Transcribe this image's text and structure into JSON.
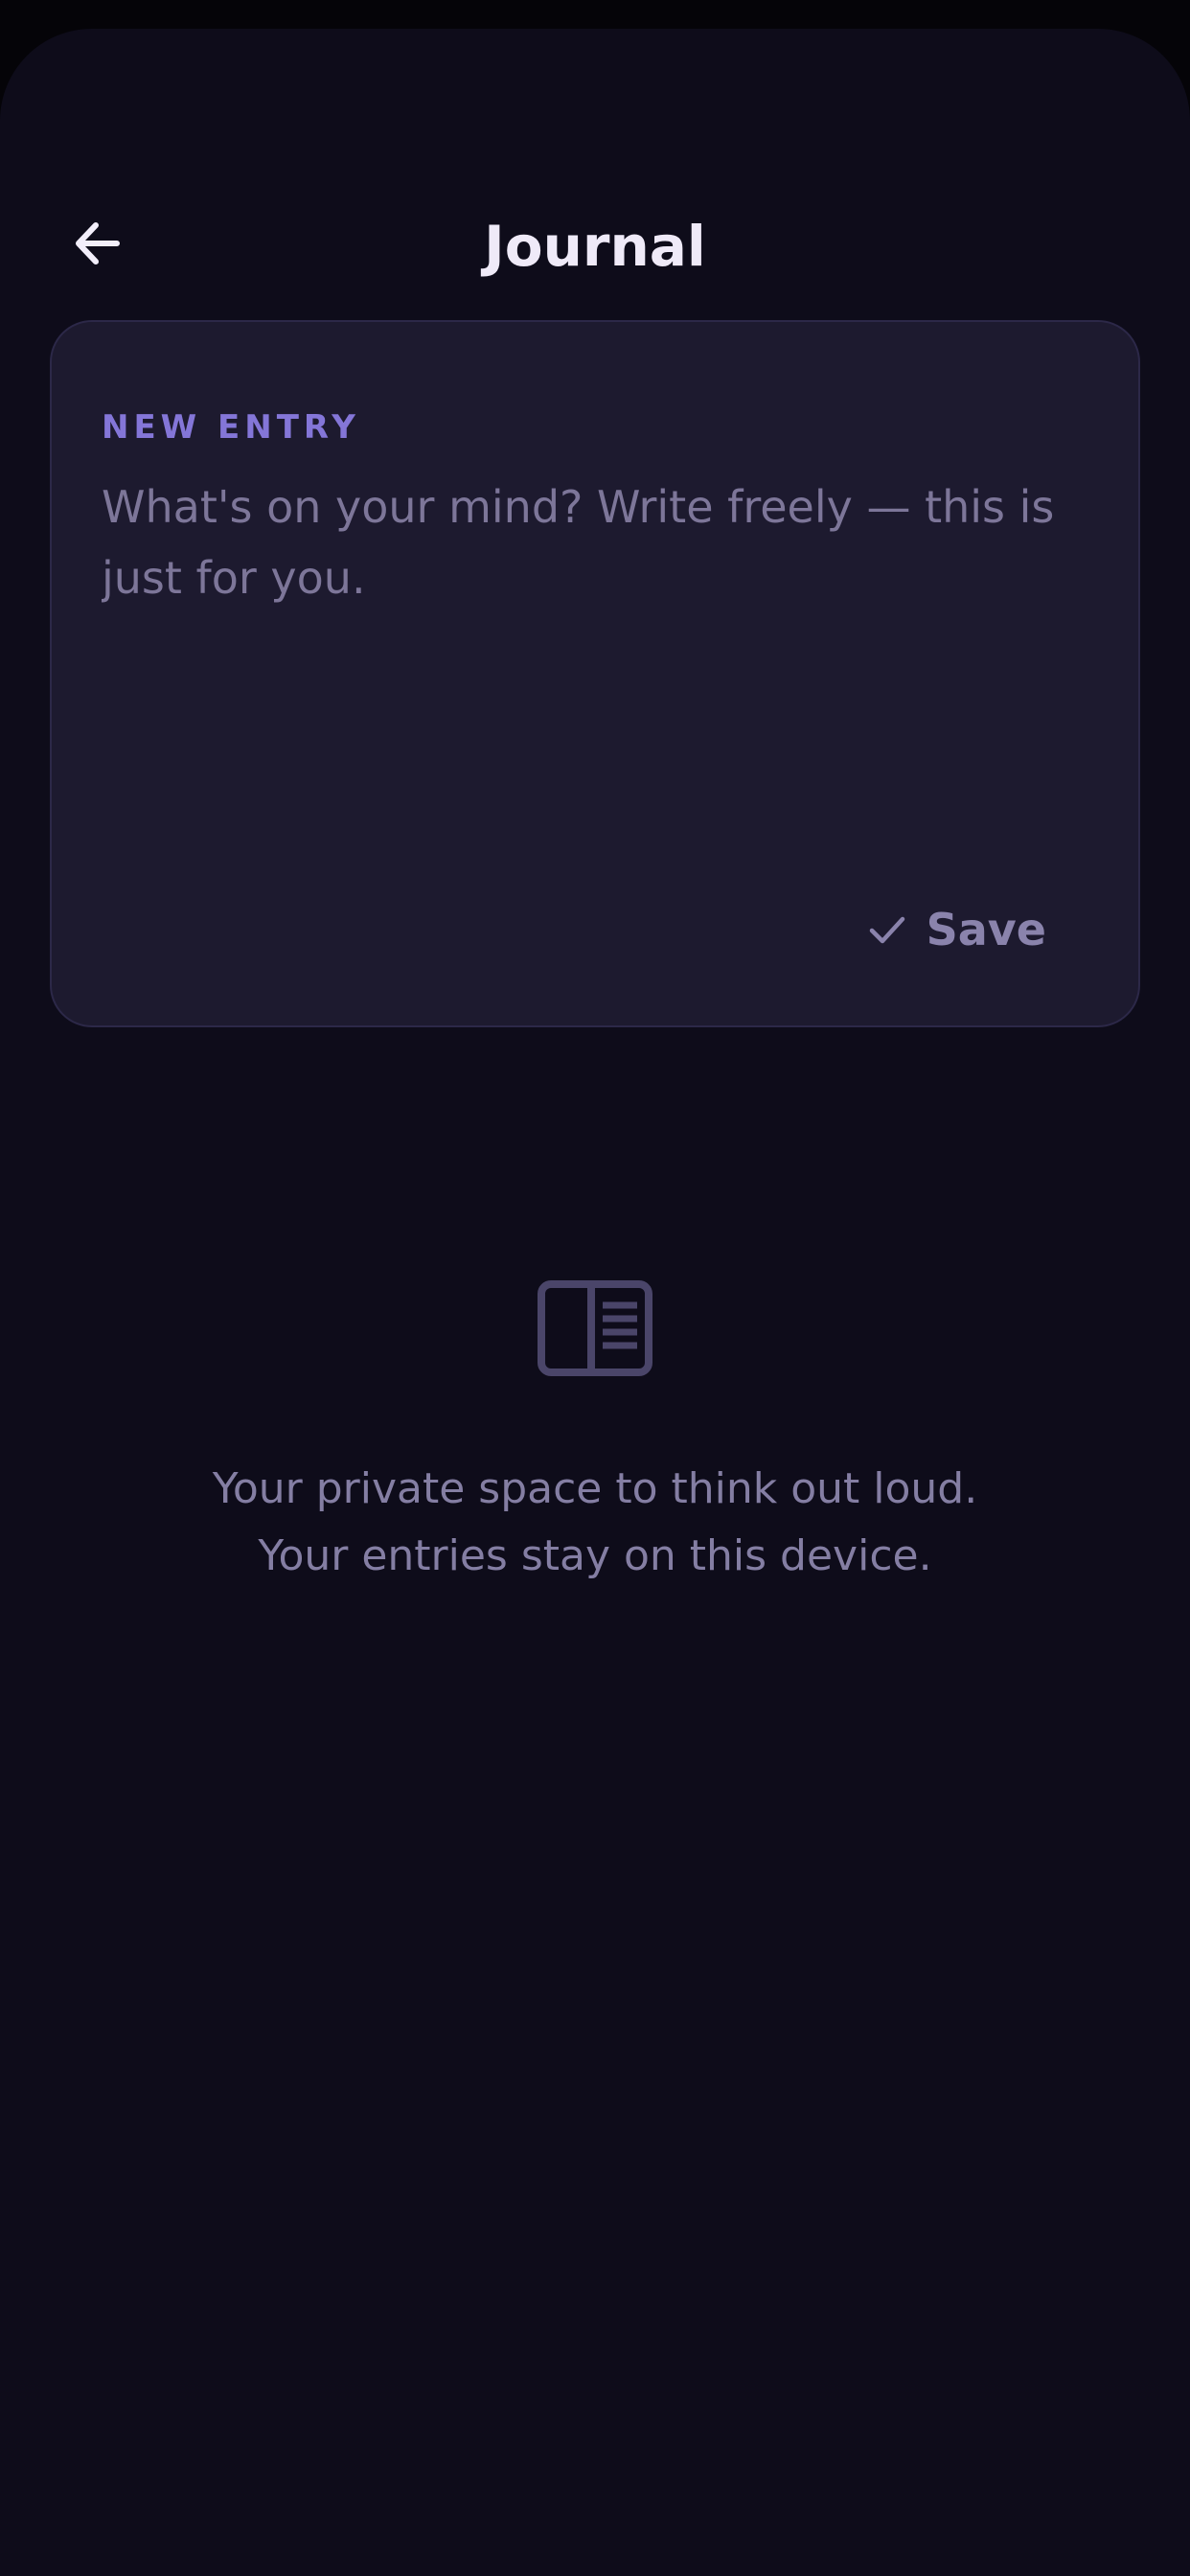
{
  "header": {
    "back_icon": "arrow-left-icon",
    "title": "Journal"
  },
  "entry_card": {
    "label": "NEW ENTRY",
    "input_value": "",
    "input_placeholder": "What's on your mind? Write freely — this is just for you.",
    "save_icon": "checkmark-icon",
    "save_label": "Save"
  },
  "empty_state": {
    "icon": "open-book-icon",
    "line1": "Your private space to think out loud.",
    "line2": "Your entries stay on this device."
  },
  "colors": {
    "background": "#0e0c1a",
    "card_background": "#1d1a2f",
    "card_border": "#2c2848",
    "accent": "#8476d8",
    "title_text": "#efeaf8",
    "muted_text": "#847ea3",
    "icon_muted": "#4a4569"
  }
}
